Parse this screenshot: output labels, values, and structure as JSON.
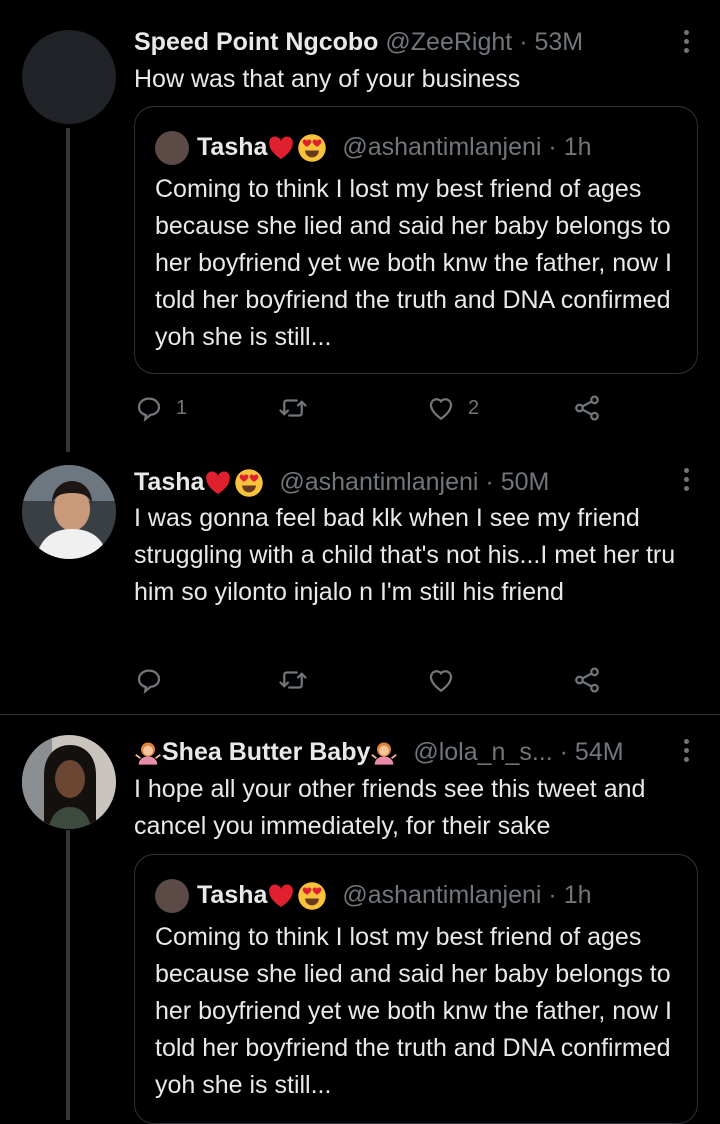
{
  "tweets": [
    {
      "name": "Speed Point Ngcobo",
      "handle": "@ZeeRight",
      "time": "53M",
      "text": "How was that any of your business",
      "quote": {
        "name": "Tasha",
        "handle": "@ashantimlanjeni",
        "time": "1h",
        "text": "Coming to think I lost my best friend of ages because she lied and said her baby belongs to her boyfriend yet we both knw the father, now I told her boyfriend the truth and DNA confirmed yoh she is still..."
      },
      "replies": "1",
      "retweets": "",
      "likes": "2"
    },
    {
      "name": "Tasha",
      "handle": "@ashantimlanjeni",
      "time": "50M",
      "text": "I was gonna feel bad klk when I see my friend struggling with a child that's not his...I met her tru him so yilonto injalo n I'm still his friend",
      "replies": "",
      "retweets": "",
      "likes": ""
    },
    {
      "name": "Shea Butter Baby",
      "handle": "@lola_n_s...",
      "time": "54M",
      "text": "I hope all your other friends see this tweet and cancel you immediately, for their sake",
      "quote": {
        "name": "Tasha",
        "handle": "@ashantimlanjeni",
        "time": "1h",
        "text": "Coming to think I lost my best friend of ages because she lied and said her baby belongs to her boyfriend yet we both knw the father, now I told her boyfriend the truth and DNA confirmed yoh she is still..."
      }
    }
  ],
  "separator": "·",
  "icons": {
    "reply": "reply-icon",
    "retweet": "retweet-icon",
    "like": "heart-icon",
    "share": "share-icon",
    "more": "more-vertical-icon",
    "heart_emoji": "red-heart-emoji",
    "heart_eyes_emoji": "heart-eyes-emoji",
    "woman_emoji": "woman-gesturing-emoji"
  },
  "colors": {
    "background": "#000000",
    "text": "#e7e9ea",
    "secondary": "#71767b",
    "border": "#2f3336"
  }
}
